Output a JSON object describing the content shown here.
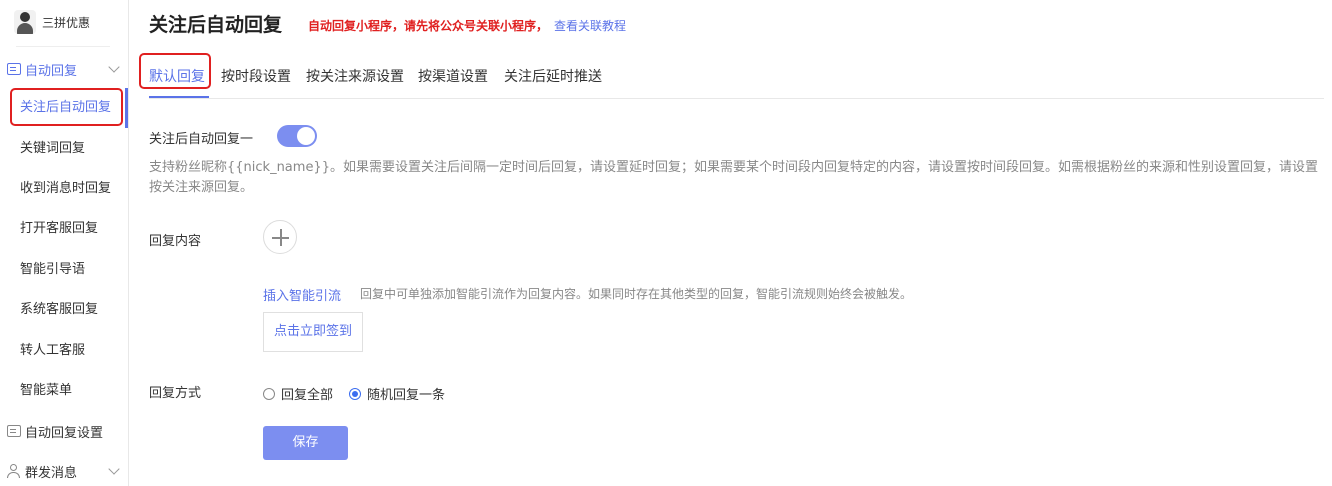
{
  "account": {
    "name": "三拼优惠"
  },
  "sidebar": {
    "group1": "自动回复",
    "items": [
      "关注后自动回复",
      "关键词回复",
      "收到消息时回复",
      "打开客服回复",
      "智能引导语",
      "系统客服回复",
      "转人工客服",
      "智能菜单"
    ],
    "group2": "自动回复设置",
    "group3": "群发消息"
  },
  "header": {
    "title": "关注后自动回复",
    "notice": "自动回复小程序，请先将公众号关联小程序，",
    "notice_link": "查看关联教程"
  },
  "tabs": [
    "默认回复",
    "按时段设置",
    "按关注来源设置",
    "按渠道设置",
    "关注后延时推送"
  ],
  "form": {
    "switch_label": "关注后自动回复一",
    "switch_on": true,
    "description": "支持粉丝昵称{{nick_name}}。如果需要设置关注后间隔一定时间后回复，请设置延时回复；如果需要某个时间段内回复特定的内容，请设置按时间段回复。如需根据粉丝的来源和性别设置回复，请设置按关注来源回复。",
    "content_label": "回复内容",
    "insert_link": "插入智能引流",
    "insert_hint": "回复中可单独添加智能引流作为回复内容。如果同时存在其他类型的回复，智能引流规则始终会被触发。",
    "content_button": "点击立即签到",
    "mode_label": "回复方式",
    "mode_options": [
      "回复全部",
      "随机回复一条"
    ],
    "mode_selected": "随机回复一条",
    "save": "保存"
  },
  "colors": {
    "accent": "#5b73e8",
    "highlight": "#e02020"
  }
}
